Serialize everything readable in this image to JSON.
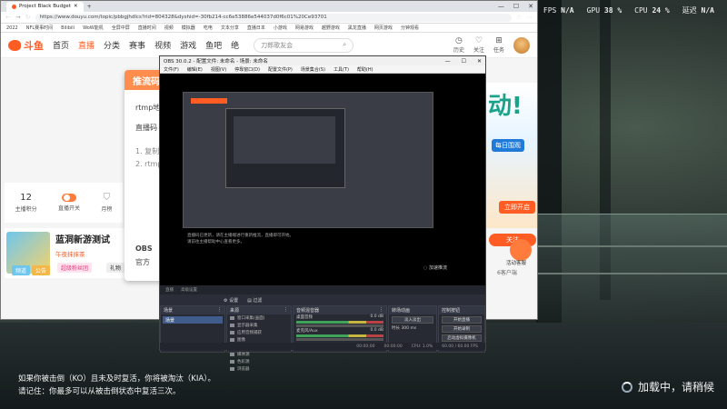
{
  "overlay": {
    "fps_label": "FPS",
    "fps_value": "N/A",
    "gpu_label": "GPU",
    "gpu_value": "38 %",
    "cpu_label": "CPU",
    "cpu_value": "24 %",
    "latency_label": "延迟",
    "latency_value": "N/A"
  },
  "game": {
    "subtitle_line1": "如果你被击倒（KO）且未及时复活，你将被淘汰（KIA）。",
    "subtitle_line2": "请记住：你最多可以从被击倒状态中复活三次。",
    "loading": "加载中，请稍候"
  },
  "browser": {
    "tab_title": "Project Black Budget",
    "url": "https://www.douyu.com/topic/pbbgjhdlcs?rid=804328&dyshid=-30fb214-cc6e53886e544037d0f6c01%20Ce93701",
    "bookmarks": [
      "2022",
      "NFL赛事时间",
      "Bilibili",
      "WoW能机",
      "全屏中屏",
      "直播时间",
      "视频",
      "模拟器",
      "吃电",
      "文本分享",
      "直播日本",
      "小游戏",
      "网易游戏",
      "越野游戏",
      "黑龙直播",
      "网页游戏",
      "分钟观看"
    ],
    "logo": "斗鱼",
    "nav": [
      "首页",
      "直播",
      "分类",
      "赛事",
      "视频",
      "游戏",
      "鱼吧",
      "绝"
    ],
    "search_placeholder": "刀郎歌友会",
    "header_icons": [
      "历史",
      "关注",
      "任务"
    ],
    "popup": {
      "title": "推流码",
      "line1": "rtmp地址",
      "line2": "直播码",
      "line3": "1. 复制直",
      "line4": "2. rtmp直",
      "line5": "OBS",
      "line6": "官方"
    },
    "tools": {
      "count": "12",
      "count_label": "主播积分",
      "toggle_label": "直播开关",
      "task_label": "月榜"
    },
    "orange_lines": [
      "流畅",
      "可重",
      "方便"
    ],
    "stream": {
      "title": "蓝洞新游测试",
      "subtitle": "午夜抹抹茶",
      "tag1": "频道",
      "tag2": "公告",
      "tag3": "超级粉丝团",
      "tag4": "礼物"
    },
    "banner": {
      "big": "动!",
      "small": "每日围观",
      "btn": "立即开启"
    },
    "follow": "关注",
    "chat": "活动客服",
    "viewers": "6客户端"
  },
  "obs": {
    "title": "OBS 30.0.2 - 配置文件: 未命名 - 场景: 未命名",
    "menu": [
      "文件(F)",
      "编辑(E)",
      "视图(V)",
      "停靠窗口(D)",
      "配置文件(P)",
      "场景集合(S)",
      "工具(T)",
      "帮助(H)"
    ],
    "preview_text_1": "直播码已更新，请在主播端进行重新推流，直播即可开始。",
    "preview_text_2": "请前往主播帮助中心查看更多。",
    "preview_btn": "加速推流",
    "bar": [
      "直播",
      "高级设置"
    ],
    "tabs": [
      "设置",
      "过滤"
    ],
    "scenes_title": "场景",
    "scene": "场景",
    "sources_title": "来源",
    "sources": [
      "窗口采集(画面)",
      "显示器采集",
      "应用音频捕获",
      "图像",
      "文本(GDI+)",
      "媒体源",
      "色彩源",
      "浏览器"
    ],
    "mixer_title": "音频混音器",
    "mixer_tracks": [
      "桌面音频",
      "麦克风/Aux"
    ],
    "mixer_levels": [
      "0.0 dB",
      "0.0 dB"
    ],
    "transitions_title": "转场动画",
    "transition": "淡入淡出",
    "duration_label": "时长",
    "duration": "300 ms",
    "controls_title": "控制按钮",
    "controls": [
      "开始直播",
      "开始录制",
      "启动虚拟摄像机",
      "工作室模式",
      "设置"
    ],
    "status": [
      "00:00:00",
      "00:00:00",
      "CPU: 1.0%",
      "60.00 / 60.00 FPS"
    ]
  }
}
